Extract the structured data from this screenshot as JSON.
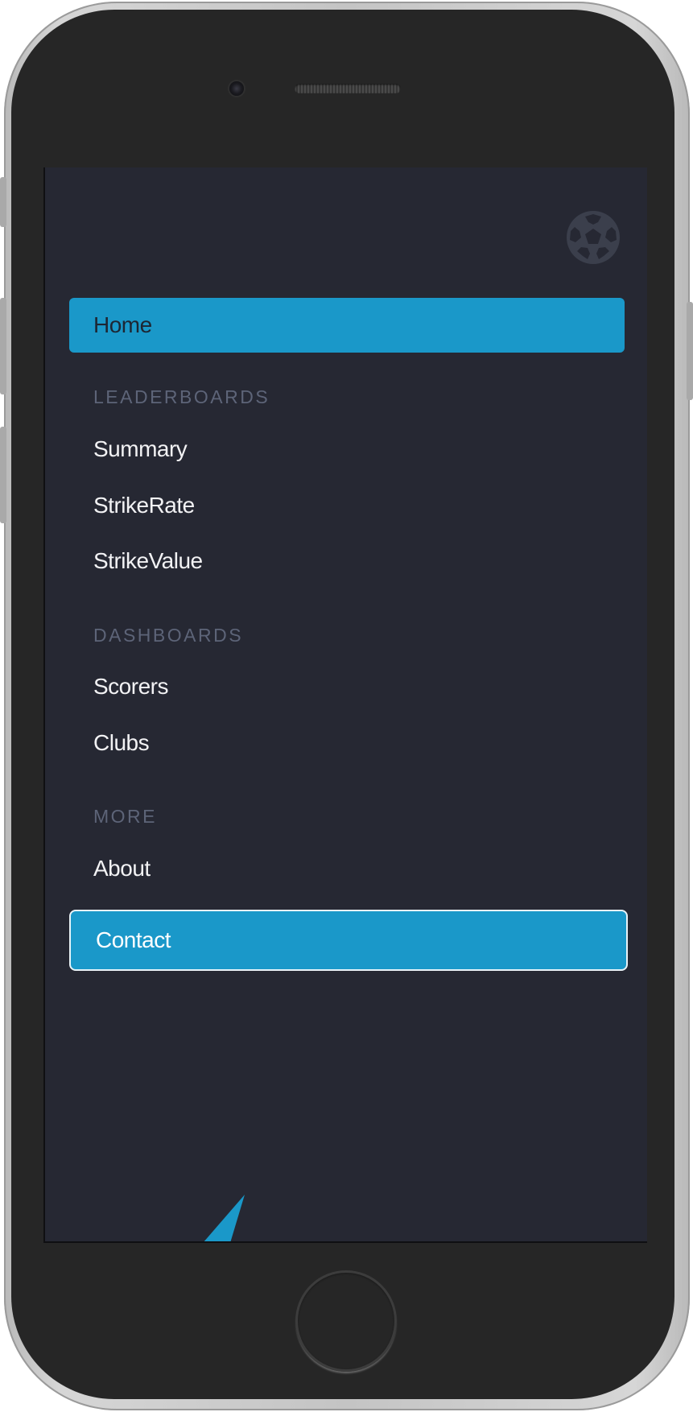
{
  "colors": {
    "screen_background": "#262833",
    "accent": "#1a98c9",
    "section_label": "#5d6478",
    "nav_text": "#f2f2f4",
    "phone_body": "#262626"
  },
  "device": {
    "icons": {
      "camera": "camera-lens",
      "speaker": "speaker-grille",
      "home": "home-button"
    }
  },
  "header": {
    "logo_icon": "soccer-ball-icon"
  },
  "menu": {
    "home": {
      "label": "Home",
      "active": true
    },
    "sections": [
      {
        "title": "LEADERBOARDS",
        "items": [
          {
            "label": "Summary"
          },
          {
            "label": "StrikeRate"
          },
          {
            "label": "StrikeValue"
          }
        ]
      },
      {
        "title": "DASHBOARDS",
        "items": [
          {
            "label": "Scorers"
          },
          {
            "label": "Clubs"
          }
        ]
      },
      {
        "title": "MORE",
        "items": [
          {
            "label": "About"
          },
          {
            "label": "Contact",
            "highlighted": true
          }
        ]
      }
    ]
  }
}
